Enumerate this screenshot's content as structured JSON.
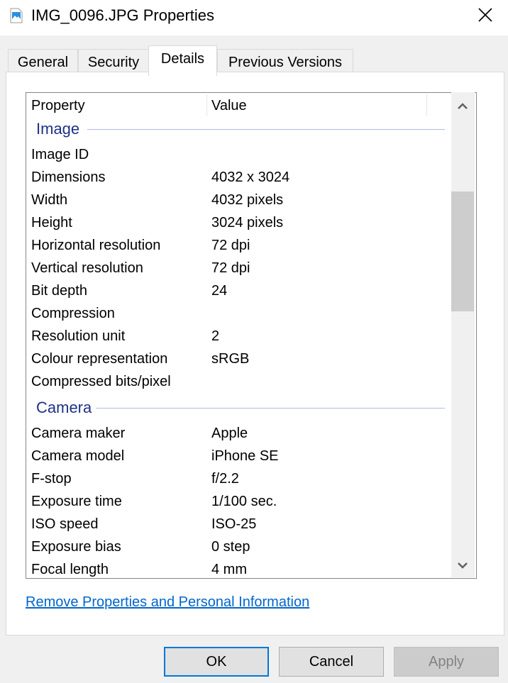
{
  "window": {
    "title": "IMG_0096.JPG Properties",
    "icon": "image-file-icon",
    "close_icon": "close-icon"
  },
  "tabs": [
    {
      "label": "General",
      "active": false
    },
    {
      "label": "Security",
      "active": false
    },
    {
      "label": "Details",
      "active": true
    },
    {
      "label": "Previous Versions",
      "active": false
    }
  ],
  "list": {
    "columns": [
      "Property",
      "Value"
    ],
    "groups": [
      {
        "name": "Image",
        "rows": [
          {
            "property": "Image ID",
            "value": ""
          },
          {
            "property": "Dimensions",
            "value": "4032 x 3024"
          },
          {
            "property": "Width",
            "value": "4032 pixels"
          },
          {
            "property": "Height",
            "value": "3024 pixels"
          },
          {
            "property": "Horizontal resolution",
            "value": "72 dpi"
          },
          {
            "property": "Vertical resolution",
            "value": "72 dpi"
          },
          {
            "property": "Bit depth",
            "value": "24"
          },
          {
            "property": "Compression",
            "value": ""
          },
          {
            "property": "Resolution unit",
            "value": "2"
          },
          {
            "property": "Colour representation",
            "value": "sRGB"
          },
          {
            "property": "Compressed bits/pixel",
            "value": ""
          }
        ]
      },
      {
        "name": "Camera",
        "rows": [
          {
            "property": "Camera maker",
            "value": "Apple"
          },
          {
            "property": "Camera model",
            "value": "iPhone SE"
          },
          {
            "property": "F-stop",
            "value": "f/2.2"
          },
          {
            "property": "Exposure time",
            "value": "1/100 sec."
          },
          {
            "property": "ISO speed",
            "value": "ISO-25"
          },
          {
            "property": "Exposure bias",
            "value": "0 step"
          },
          {
            "property": "Focal length",
            "value": "4 mm"
          }
        ]
      }
    ],
    "scroll_position_fraction": 0.3
  },
  "link": {
    "label": "Remove Properties and Personal Information"
  },
  "buttons": {
    "ok": "OK",
    "cancel": "Cancel",
    "apply": "Apply"
  },
  "colors": {
    "group_heading": "#1e3287",
    "link": "#0066cc",
    "default_button_border": "#0078d7"
  }
}
